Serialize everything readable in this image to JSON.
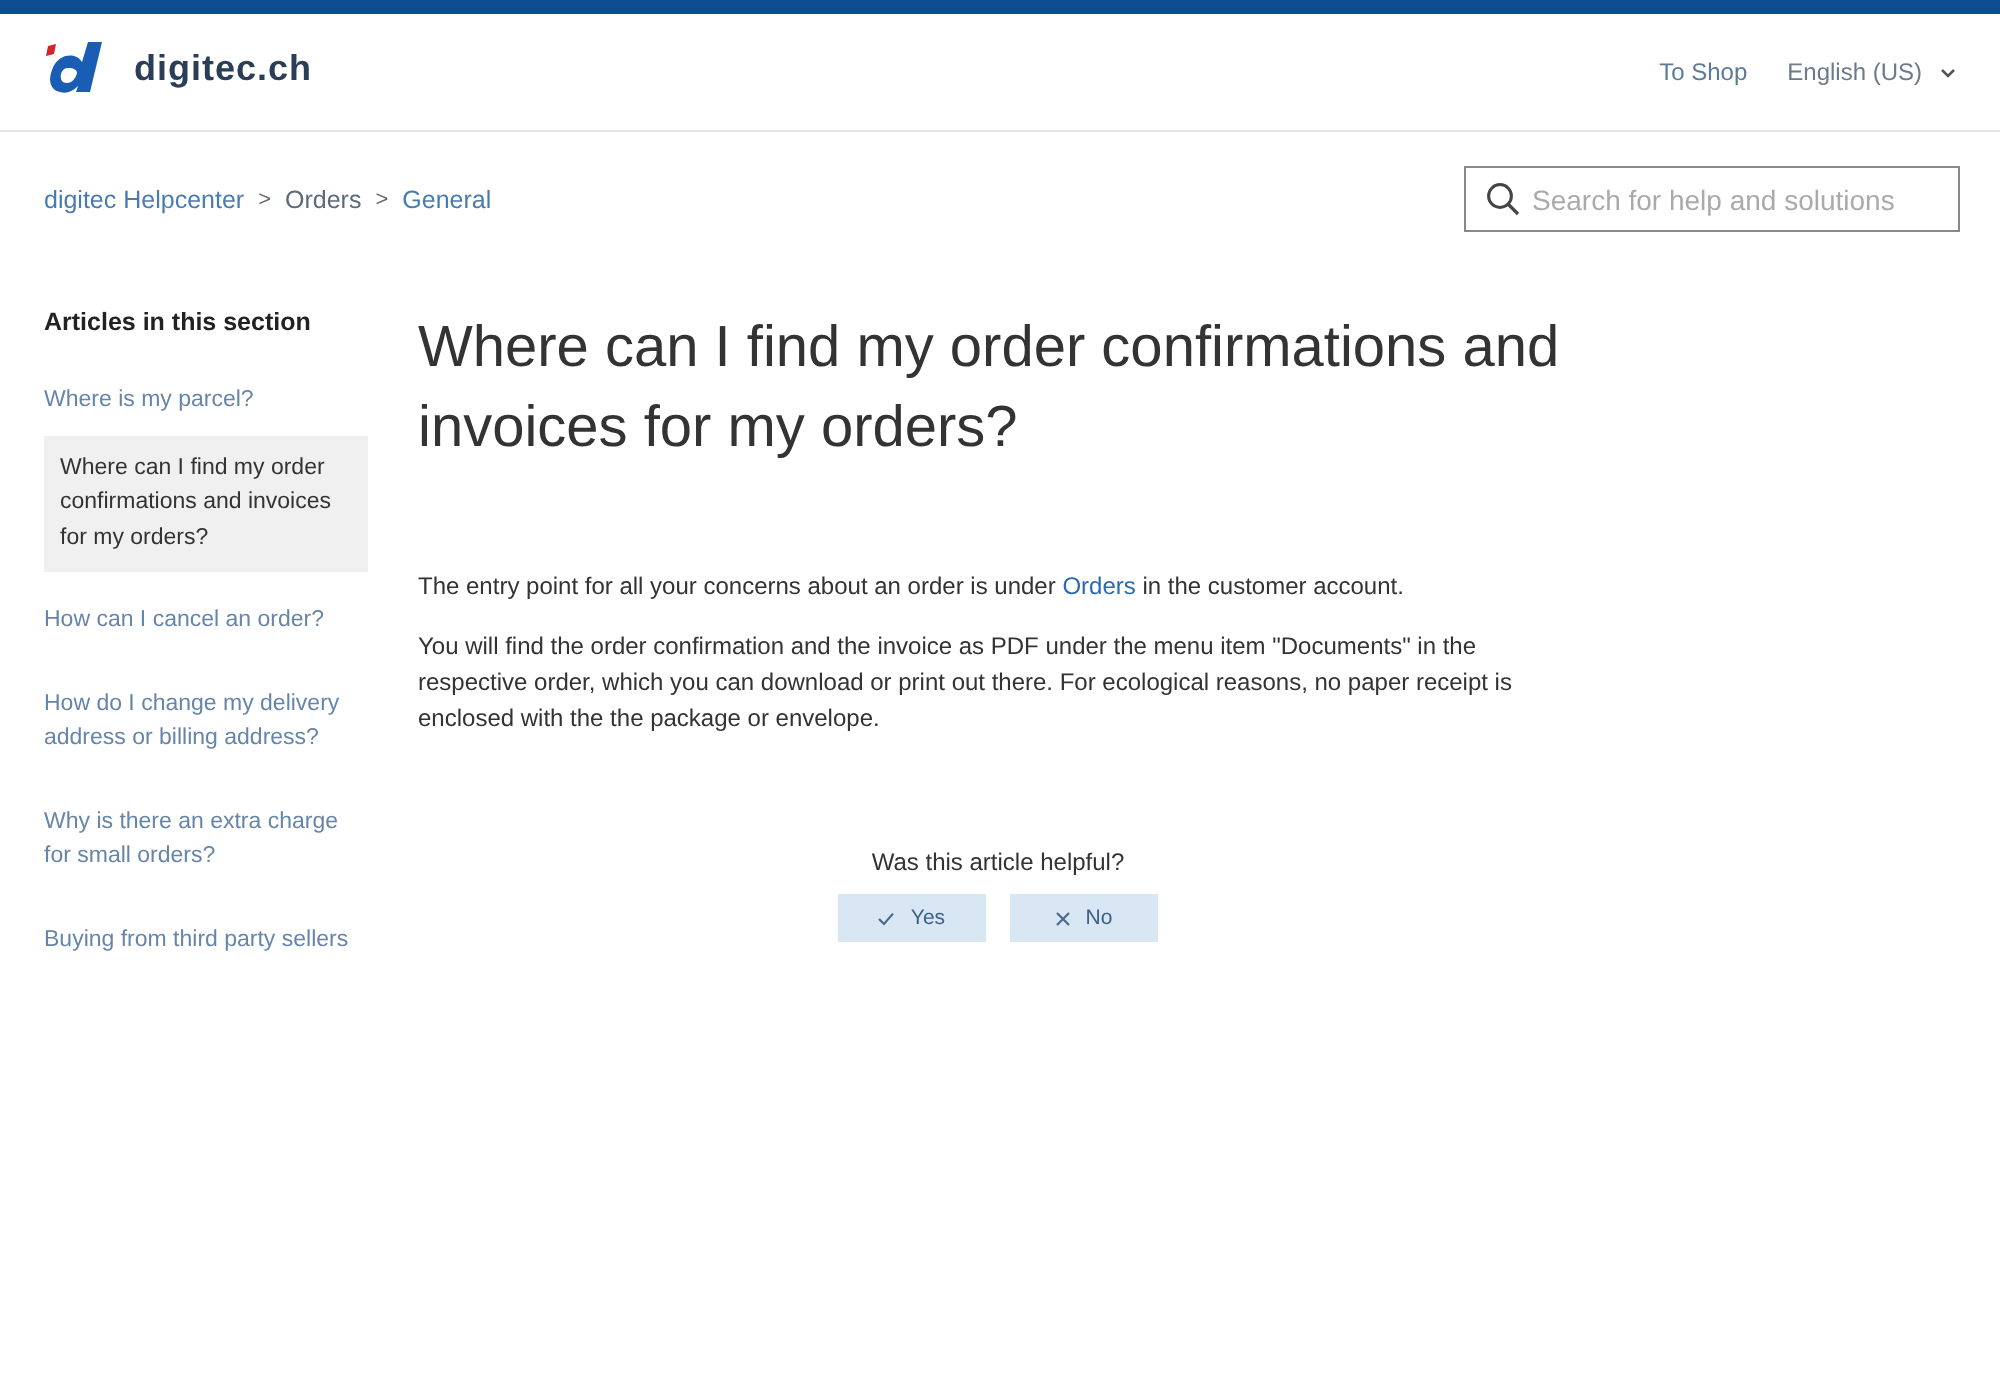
{
  "header": {
    "logo_text": "digitec.ch",
    "nav": [
      {
        "label": "To Shop",
        "kind": "link"
      },
      {
        "label": "English (US)",
        "kind": "dropdown"
      }
    ]
  },
  "breadcrumb": [
    "digitec Helpcenter",
    "Orders",
    "General"
  ],
  "breadcrumb_separator": ">",
  "search": {
    "placeholder": "Search for help and solutions"
  },
  "sidebar": {
    "title": "Articles in this section",
    "items": [
      {
        "label": "Where is my parcel?",
        "selected": false
      },
      {
        "label": "Where can I find my order confirmations and invoices for my orders?",
        "selected": true
      },
      {
        "label": "How can I cancel an order?",
        "selected": false
      },
      {
        "label": "How do I change my delivery address or billing address?",
        "selected": false
      },
      {
        "label": "Why is there an extra charge for small orders?",
        "selected": false
      },
      {
        "label": "Buying from third party sellers",
        "selected": false
      }
    ]
  },
  "article": {
    "title": "Where can I find my order confirmations and invoices for my orders?",
    "paragraphs": [
      [
        {
          "text": "The entry point for all your concerns about an order is under ",
          "kind": "text"
        },
        {
          "text": "Orders",
          "kind": "link"
        },
        {
          "text": " in the customer account.",
          "kind": "text"
        }
      ],
      [
        {
          "kind": "text",
          "text": "You will find the order confirmation and the invoice as PDF under the menu item \"Documents\" in the respective order, which you can download or print out there. For ecological reasons, no paper receipt is enclosed with the the package or envelope."
        }
      ]
    ]
  },
  "feedback": {
    "question": "Was this article helpful?",
    "buttons": [
      {
        "label": "Yes",
        "kind": "yes"
      },
      {
        "label": "No",
        "kind": "no"
      }
    ]
  }
}
